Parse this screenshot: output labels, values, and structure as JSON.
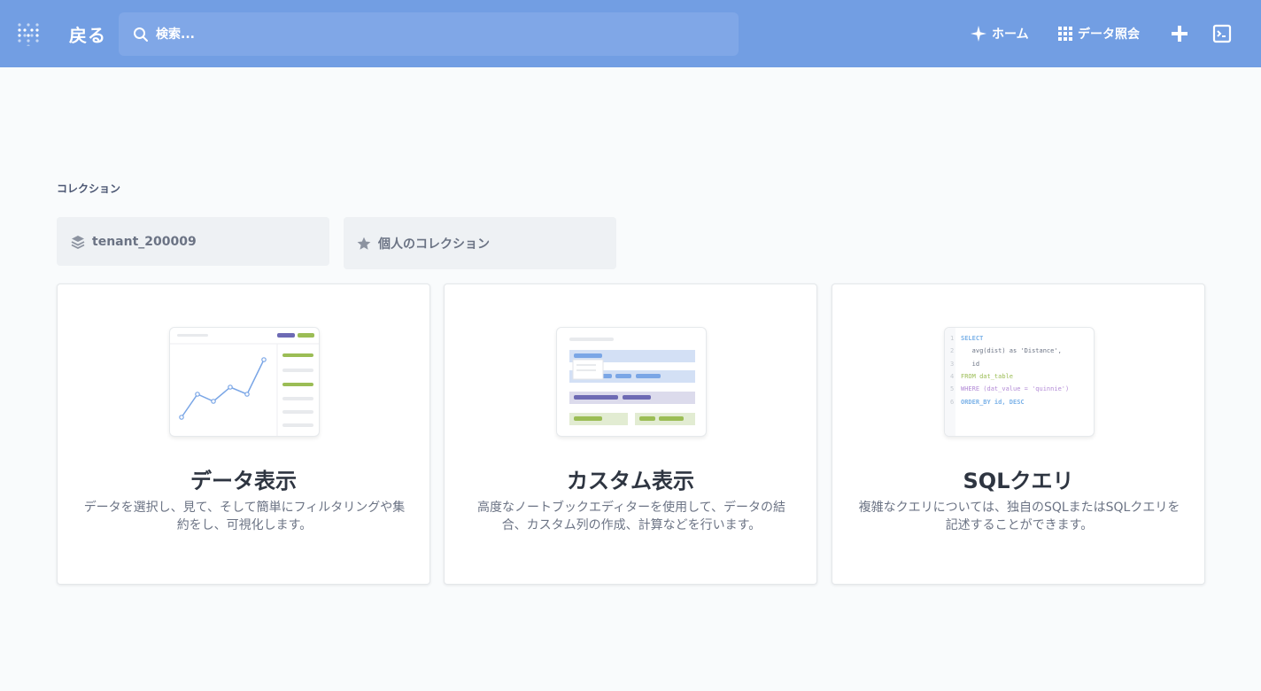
{
  "header": {
    "back_label": "戻る",
    "search_placeholder": "検索...",
    "nav_home_label": "ホーム",
    "nav_browse_label": "データ照会"
  },
  "collections": {
    "title": "コレクション",
    "items": [
      {
        "label": "tenant_200009",
        "icon": "layers-icon"
      },
      {
        "label": "個人のコレクション",
        "icon": "star-icon"
      }
    ]
  },
  "cards": [
    {
      "title": "データ表示",
      "description": "データを選択し、見て、そして簡単にフィルタリングや集約をし、可視化します。"
    },
    {
      "title": "カスタム表示",
      "description": "高度なノートブックエディターを使用して、データの結合、カスタム列の作成、計算などを行います。"
    },
    {
      "title": "SQLクエリ",
      "description": "複雑なクエリについては、独自のSQLまたはSQLクエリを記述することができます。",
      "code_lines": [
        "SELECT",
        "   avg(dist) as 'Distance',",
        "   id",
        "FROM dat_table",
        "WHERE (dat_value = 'quinnie')",
        "ORDER_BY id, DESC"
      ],
      "line_numbers": [
        "1",
        "2",
        "3",
        "4",
        "5",
        "6"
      ]
    }
  ],
  "colors": {
    "header_bg": "#729ee3",
    "accent_green": "#9bbd55",
    "accent_purple": "#6d6ab4",
    "accent_blue": "#7aa6e6"
  }
}
